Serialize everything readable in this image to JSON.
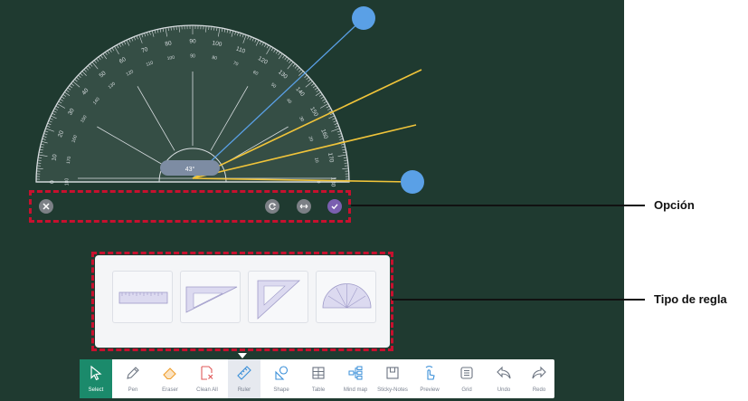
{
  "protractor": {
    "angle_readout": "43°",
    "scale_outer": [
      "0",
      "10",
      "20",
      "30",
      "40",
      "50",
      "60",
      "70",
      "80",
      "90",
      "100",
      "110",
      "120",
      "130",
      "140",
      "150",
      "160",
      "170",
      "180"
    ],
    "scale_inner": [
      "180",
      "170",
      "160",
      "150",
      "140",
      "130",
      "120",
      "110",
      "100",
      "90",
      "80",
      "70",
      "60",
      "50",
      "40",
      "30",
      "20",
      "10",
      "0"
    ]
  },
  "option_bar": {
    "close_icon": "close-icon",
    "reset_icon": "rotate-icon",
    "flip_icon": "flip-horizontal-icon",
    "confirm_icon": "check-icon"
  },
  "annotations": {
    "option_label": "Opción",
    "ruler_type_label": "Tipo de regla"
  },
  "ruler_types": [
    {
      "name": "straight-ruler-icon"
    },
    {
      "name": "triangle-30-60-icon"
    },
    {
      "name": "triangle-45-icon"
    },
    {
      "name": "protractor-icon"
    }
  ],
  "toolbar": {
    "items": [
      {
        "label": "Select",
        "icon": "cursor-icon"
      },
      {
        "label": "Pen",
        "icon": "pen-icon"
      },
      {
        "label": "Eraser",
        "icon": "eraser-icon"
      },
      {
        "label": "Clean All",
        "icon": "clean-all-icon"
      },
      {
        "label": "Ruler",
        "icon": "ruler-icon"
      },
      {
        "label": "Shape",
        "icon": "shape-icon"
      },
      {
        "label": "Table",
        "icon": "table-icon"
      },
      {
        "label": "Mind map",
        "icon": "mind-map-icon"
      },
      {
        "label": "Sticky-Notes",
        "icon": "sticky-note-icon"
      },
      {
        "label": "Preview",
        "icon": "preview-icon"
      },
      {
        "label": "Grid",
        "icon": "grid-icon"
      },
      {
        "label": "Undo",
        "icon": "undo-icon"
      },
      {
        "label": "Redo",
        "icon": "redo-icon"
      }
    ],
    "active_item": "Select",
    "highlighted_item": "Ruler"
  },
  "colors": {
    "board": "#1f3a30",
    "annotation_dash": "#c8102e",
    "accent_green": "#1b8a6b",
    "handle_blue": "#5aa0e6",
    "angle_line_yellow": "#f0c43a"
  }
}
